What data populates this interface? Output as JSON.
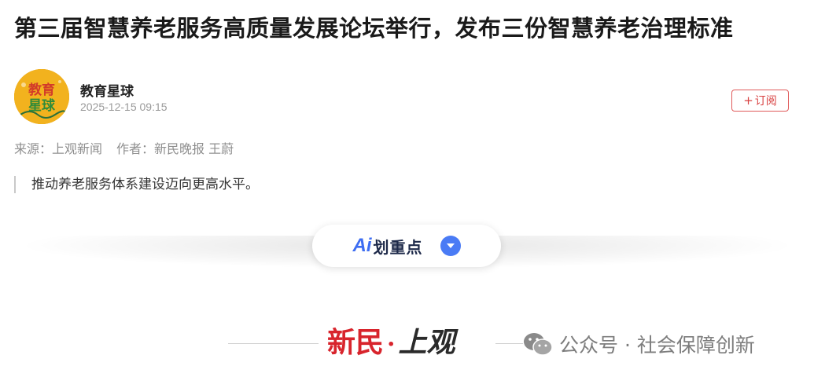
{
  "article": {
    "title": "第三届智慧养老服务高质量发展论坛举行，发布三份智慧养老治理标准",
    "summary": "推动养老服务体系建设迈向更高水平。"
  },
  "author_card": {
    "avatar_text_top": "教育",
    "avatar_text_bottom": "星球",
    "name": "教育星球",
    "time": "2025-12-15 09:15",
    "subscribe_label": "订阅"
  },
  "meta": {
    "source": "来源：上观新闻",
    "author": "作者：新民晚报 王蔚"
  },
  "ai_highlight": {
    "logo": "Ai",
    "label": "划重点"
  },
  "brand": {
    "part1": "新民",
    "separator": "·",
    "part2": "上观"
  },
  "watermark": {
    "text": "公众号 · 社会保障创新"
  },
  "colors": {
    "accent_red": "#d8242c",
    "ai_blue": "#4a7bf5",
    "avatar_yellow": "#f2b21e"
  }
}
